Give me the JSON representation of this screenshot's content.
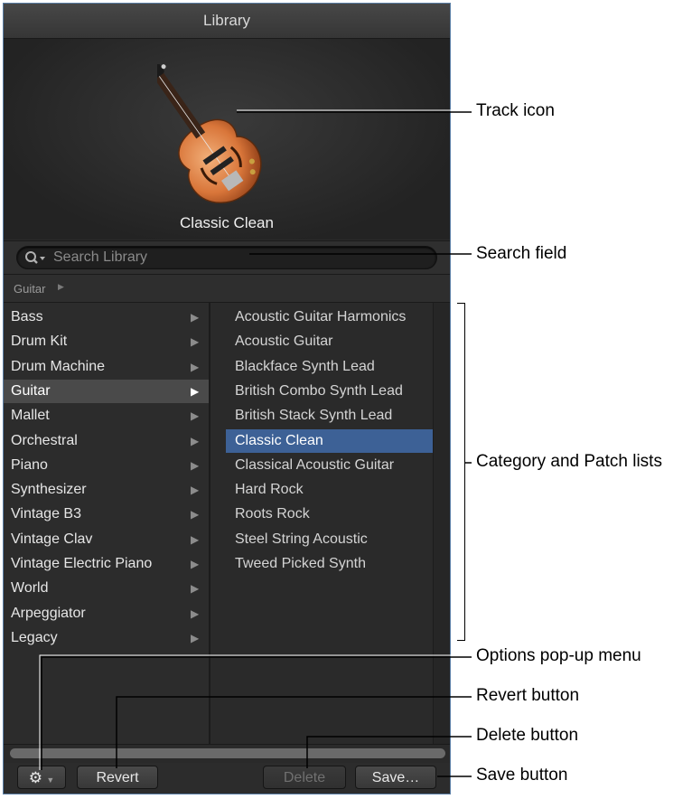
{
  "window": {
    "title": "Library"
  },
  "header": {
    "patch_name": "Classic Clean",
    "icon": "guitar-icon"
  },
  "search": {
    "placeholder": "Search Library",
    "value": ""
  },
  "breadcrumb": {
    "label": "Guitar"
  },
  "categories": [
    {
      "label": "Bass"
    },
    {
      "label": "Drum Kit"
    },
    {
      "label": "Drum Machine"
    },
    {
      "label": "Guitar",
      "selected": true
    },
    {
      "label": "Mallet"
    },
    {
      "label": "Orchestral"
    },
    {
      "label": "Piano"
    },
    {
      "label": "Synthesizer"
    },
    {
      "label": "Vintage B3"
    },
    {
      "label": "Vintage Clav"
    },
    {
      "label": "Vintage Electric Piano"
    },
    {
      "label": "World"
    },
    {
      "label": "Arpeggiator"
    },
    {
      "label": "Legacy"
    }
  ],
  "patches": [
    {
      "label": "Acoustic Guitar Harmonics"
    },
    {
      "label": "Acoustic Guitar"
    },
    {
      "label": "Blackface Synth Lead"
    },
    {
      "label": "British Combo Synth Lead"
    },
    {
      "label": "British Stack Synth Lead"
    },
    {
      "label": "Classic Clean",
      "selected": true
    },
    {
      "label": "Classical Acoustic Guitar"
    },
    {
      "label": "Hard Rock"
    },
    {
      "label": "Roots Rock"
    },
    {
      "label": "Steel String Acoustic"
    },
    {
      "label": "Tweed Picked Synth"
    }
  ],
  "toolbar": {
    "options_icon": "gear-icon",
    "revert_label": "Revert",
    "delete_label": "Delete",
    "save_label": "Save…"
  },
  "callouts": {
    "track_icon": "Track icon",
    "search_field": "Search field",
    "lists": "Category and Patch lists",
    "options_menu": "Options pop-up menu",
    "revert_button": "Revert button",
    "delete_button": "Delete button",
    "save_button": "Save button"
  },
  "colors": {
    "selection": "#3d6196",
    "panel_border": "#5b7fa6",
    "background": "#2b2b2b"
  }
}
